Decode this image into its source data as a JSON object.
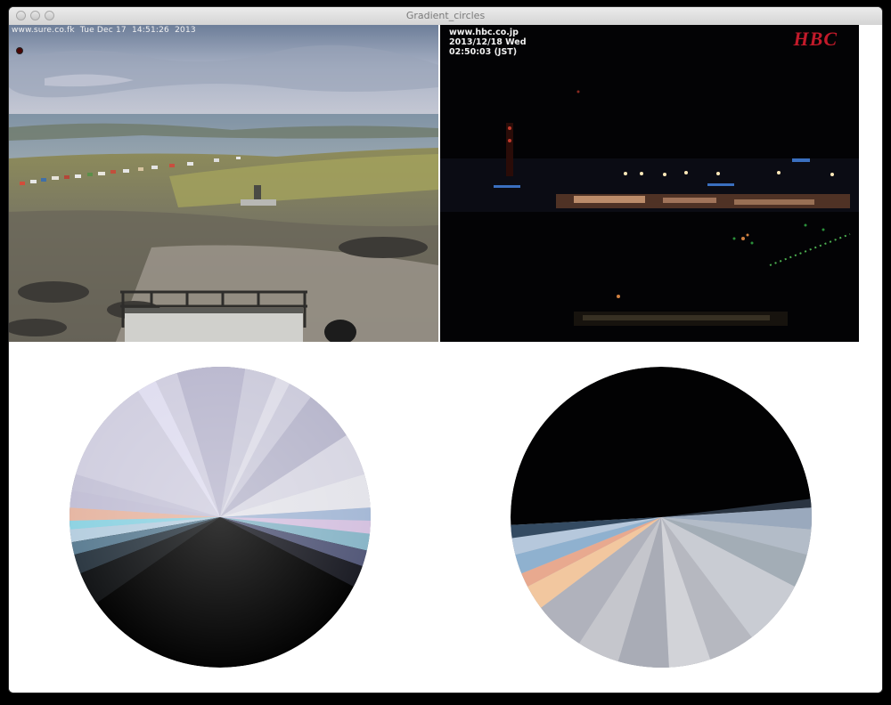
{
  "window": {
    "title": "Gradient_circles"
  },
  "webcam_left": {
    "caption": "www.sure.co.fk  Tue Dec 17  14:51:26  2013"
  },
  "webcam_right": {
    "caption_line1": "www.hbc.co.jp",
    "caption_line2": "2013/12/18 Wed",
    "caption_line3": "02:50:03 (JST)",
    "logo": "HBC"
  },
  "gradient_circles": [
    {
      "name": "daytime-circle",
      "description_colors": {
        "sky": "#c8c6dc",
        "band": "#7fc1d6",
        "ground": "#050505"
      }
    },
    {
      "name": "night-circle",
      "description_colors": {
        "sky": "#000000",
        "lights": "#f3c6a0",
        "ground": "#bfc2cc"
      }
    }
  ],
  "icons": [
    "traffic-light-close-icon",
    "traffic-light-minimize-icon",
    "traffic-light-zoom-icon",
    "recording-dot-icon"
  ]
}
